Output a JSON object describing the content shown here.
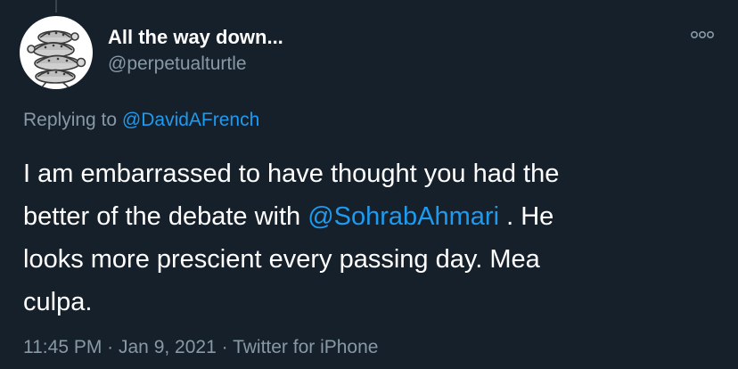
{
  "tweet": {
    "author": {
      "display_name": "All the way down...",
      "handle": "@perpetualturtle",
      "avatar_icon": "turtle-stack-avatar"
    },
    "more_icon": "more-options-icon",
    "replying_to": {
      "prefix": "Replying to ",
      "mention": "@DavidAFrench"
    },
    "text": {
      "line1": "I am embarrassed to have thought you had the",
      "line2_before": "better of the debate with ",
      "line2_mention": "@SohrabAhmari",
      "line2_after": " . He",
      "line3": "looks more prescient every passing day. Mea",
      "line4": "culpa."
    },
    "meta": {
      "time": "11:45 PM",
      "separator": " · ",
      "date": "Jan 9, 2021",
      "source": "Twitter for iPhone"
    }
  },
  "colors": {
    "background": "#15202b",
    "text": "#ffffff",
    "secondary": "#8899a6",
    "link": "#1d9bf0"
  }
}
